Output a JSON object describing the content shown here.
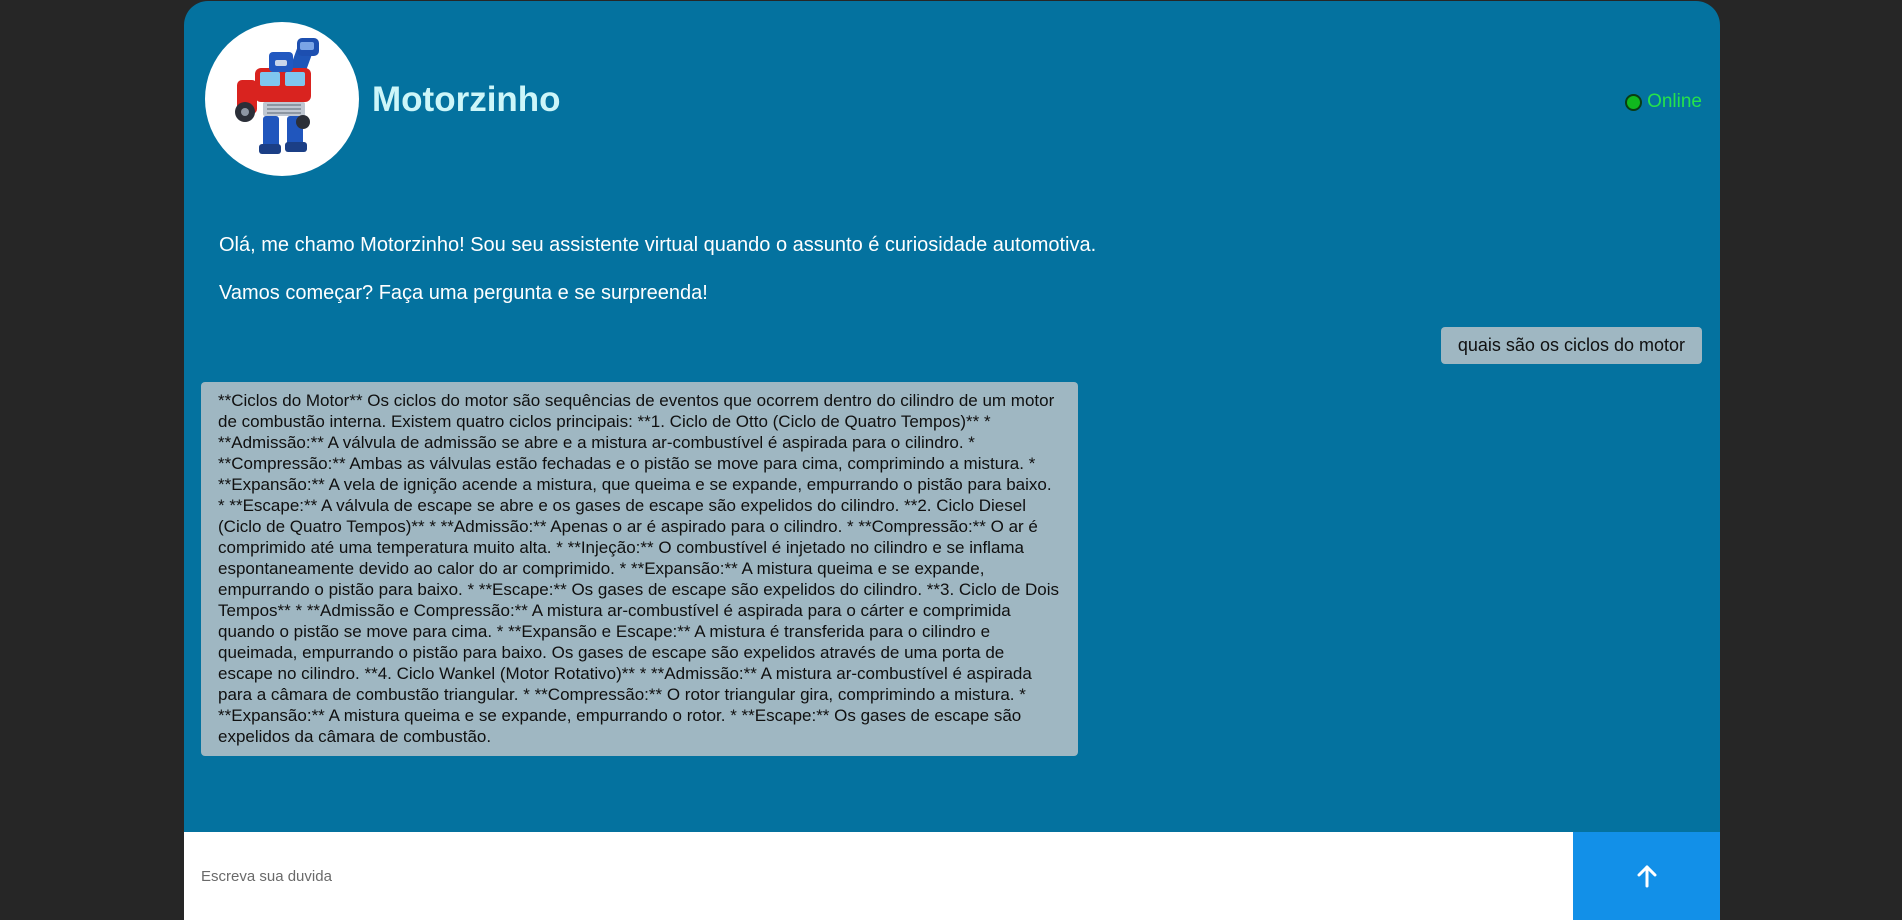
{
  "header": {
    "bot_name": "Motorzinho",
    "status": "Online",
    "avatar_icon": "robot-truck-mascot"
  },
  "messages": {
    "welcome_line_1": "Olá, me chamo Motorzinho! Sou seu assistente virtual quando o assunto é curiosidade automotiva.",
    "welcome_line_2": "Vamos começar? Faça uma pergunta e se surpreenda!",
    "user_question": "quais são os ciclos do motor",
    "bot_answer": "**Ciclos do Motor** Os ciclos do motor são sequências de eventos que ocorrem dentro do cilindro de um motor de combustão interna. Existem quatro ciclos principais: **1. Ciclo de Otto (Ciclo de Quatro Tempos)** * **Admissão:** A válvula de admissão se abre e a mistura ar-combustível é aspirada para o cilindro. * **Compressão:** Ambas as válvulas estão fechadas e o pistão se move para cima, comprimindo a mistura. * **Expansão:** A vela de ignição acende a mistura, que queima e se expande, empurrando o pistão para baixo. * **Escape:** A válvula de escape se abre e os gases de escape são expelidos do cilindro. **2. Ciclo Diesel (Ciclo de Quatro Tempos)** * **Admissão:** Apenas o ar é aspirado para o cilindro. * **Compressão:** O ar é comprimido até uma temperatura muito alta. * **Injeção:** O combustível é injetado no cilindro e se inflama espontaneamente devido ao calor do ar comprimido. * **Expansão:** A mistura queima e se expande, empurrando o pistão para baixo. * **Escape:** Os gases de escape são expelidos do cilindro. **3. Ciclo de Dois Tempos** * **Admissão e Compressão:** A mistura ar-combustível é aspirada para o cárter e comprimida quando o pistão se move para cima. * **Expansão e Escape:** A mistura é transferida para o cilindro e queimada, empurrando o pistão para baixo. Os gases de escape são expelidos através de uma porta de escape no cilindro. **4. Ciclo Wankel (Motor Rotativo)** * **Admissão:** A mistura ar-combustível é aspirada para a câmara de combustão triangular. * **Compressão:** O rotor triangular gira, comprimindo a mistura. * **Expansão:** A mistura queima e se expande, empurrando o rotor. * **Escape:** Os gases de escape são expelidos da câmara de combustão."
  },
  "input": {
    "placeholder": "Escreva sua duvida",
    "value": "",
    "send_icon": "arrow-up-icon"
  },
  "colors": {
    "page_background": "#262626",
    "chat_background": "#04729f",
    "bubble_background": "#9fb7c2",
    "bot_name_color": "#cdf6f9",
    "status_color": "#25e34b",
    "send_button": "#1290e8"
  }
}
